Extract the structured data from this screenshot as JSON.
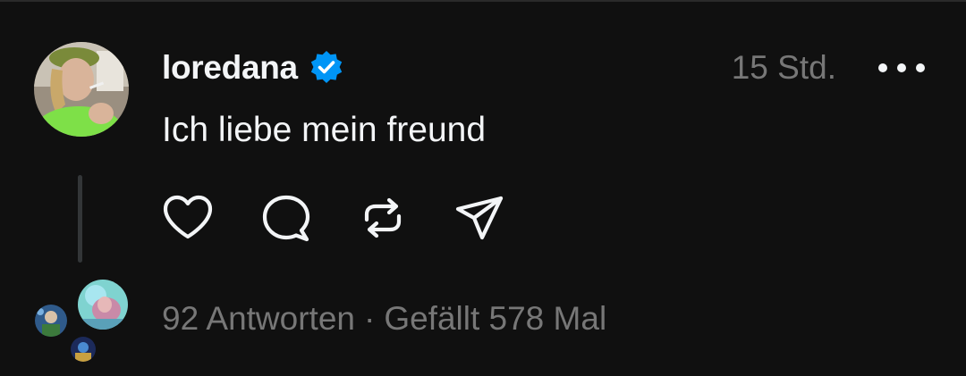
{
  "post": {
    "username": "loredana",
    "verified": true,
    "timestamp": "15 Std.",
    "text": "Ich liebe mein freund"
  },
  "stats": {
    "replies": "92 Antworten",
    "separator": "·",
    "likes": "Gefällt 578 Mal"
  },
  "actions": [
    "heart-icon",
    "comment-icon",
    "repost-icon",
    "share-icon"
  ],
  "colors": {
    "background": "#101010",
    "text": "#f3f5f7",
    "muted": "#777777",
    "verified": "#0095f6",
    "thread_line": "#333638"
  }
}
